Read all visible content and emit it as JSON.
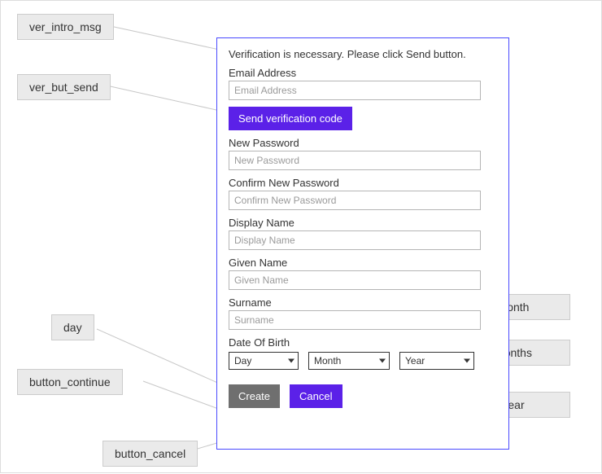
{
  "callouts": {
    "ver_intro_msg": "ver_intro_msg",
    "ver_but_send": "ver_but_send",
    "day": "day",
    "button_continue": "button_continue",
    "button_cancel": "button_cancel",
    "month": "month",
    "months": "months",
    "year": "year"
  },
  "form": {
    "intro": "Verification is necessary. Please click Send button.",
    "email_label": "Email Address",
    "email_placeholder": "Email Address",
    "send_btn": "Send verification code",
    "newpw_label": "New Password",
    "newpw_placeholder": "New Password",
    "confirmpw_label": "Confirm New Password",
    "confirmpw_placeholder": "Confirm New Password",
    "display_label": "Display Name",
    "display_placeholder": "Display Name",
    "given_label": "Given Name",
    "given_placeholder": "Given Name",
    "surname_label": "Surname",
    "surname_placeholder": "Surname",
    "dob_label": "Date Of Birth",
    "dob_day": "Day",
    "dob_month": "Month",
    "dob_year": "Year",
    "create_btn": "Create",
    "cancel_btn": "Cancel"
  }
}
